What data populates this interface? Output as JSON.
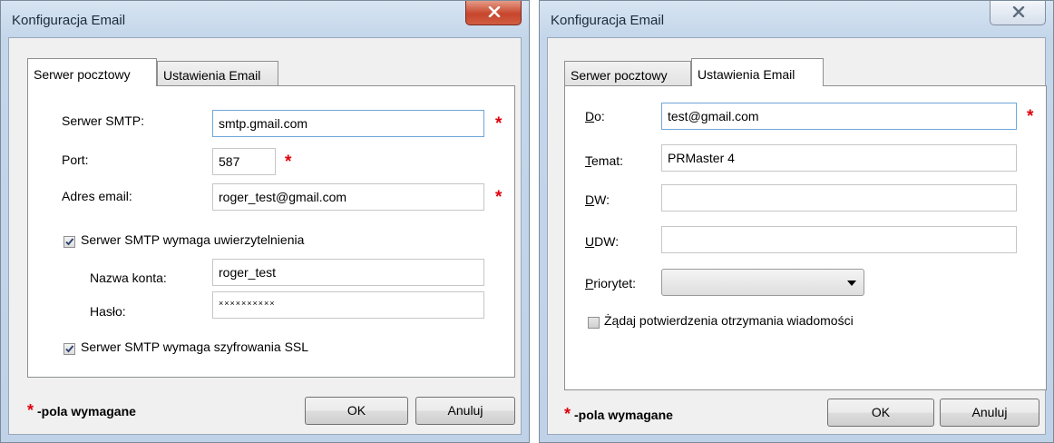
{
  "dialog1": {
    "title": "Konfiguracja Email",
    "tabs": [
      {
        "label": "Serwer pocztowy",
        "active": true
      },
      {
        "label": "Ustawienia Email",
        "active": false
      }
    ],
    "smtp_server": {
      "label": "Serwer SMTP:",
      "value": "smtp.gmail.com"
    },
    "port": {
      "label": "Port:",
      "value": "587"
    },
    "email_address": {
      "label": "Adres email:",
      "value": "roger_test@gmail.com"
    },
    "auth_required": {
      "label": "Serwer SMTP wymaga uwierzytelnienia",
      "checked": true
    },
    "account_name": {
      "label": "Nazwa konta:",
      "value": "roger_test"
    },
    "password": {
      "label": "Hasło:",
      "value": "××××××××××"
    },
    "ssl_required": {
      "label": "Serwer SMTP wymaga szyfrowania SSL",
      "checked": true
    },
    "required_marker": "*",
    "required_note": "-pola wymagane",
    "ok_label": "OK",
    "cancel_label": "Anuluj"
  },
  "dialog2": {
    "title": "Konfiguracja Email",
    "tabs": [
      {
        "label": "Serwer pocztowy",
        "active": false
      },
      {
        "label": "Ustawienia Email",
        "active": true
      }
    ],
    "to": {
      "label_underlined": "D",
      "label_rest": "o:",
      "value": "test@gmail.com"
    },
    "subject": {
      "label_underlined": "T",
      "label_rest": "emat:",
      "value": "PRMaster 4"
    },
    "cc": {
      "label_underlined": "D",
      "label_rest": "W:",
      "value": ""
    },
    "bcc": {
      "label_underlined": "U",
      "label_rest": "DW:",
      "value": ""
    },
    "priority": {
      "label_underlined": "P",
      "label_rest": "riorytet:",
      "value": ""
    },
    "read_receipt": {
      "label": "Żądaj potwierdzenia otrzymania wiadomości",
      "checked": false
    },
    "required_marker": "*",
    "required_note": "-pola wymagane",
    "ok_label": "OK",
    "cancel_label": "Anuluj"
  },
  "icons": {
    "close": "close-x-icon",
    "check": "checkmark-icon",
    "dropdown": "chevron-down-icon"
  },
  "colors": {
    "required": "#e0000b",
    "close_button": "#c7462c",
    "focus_border": "#6fa6d9"
  }
}
